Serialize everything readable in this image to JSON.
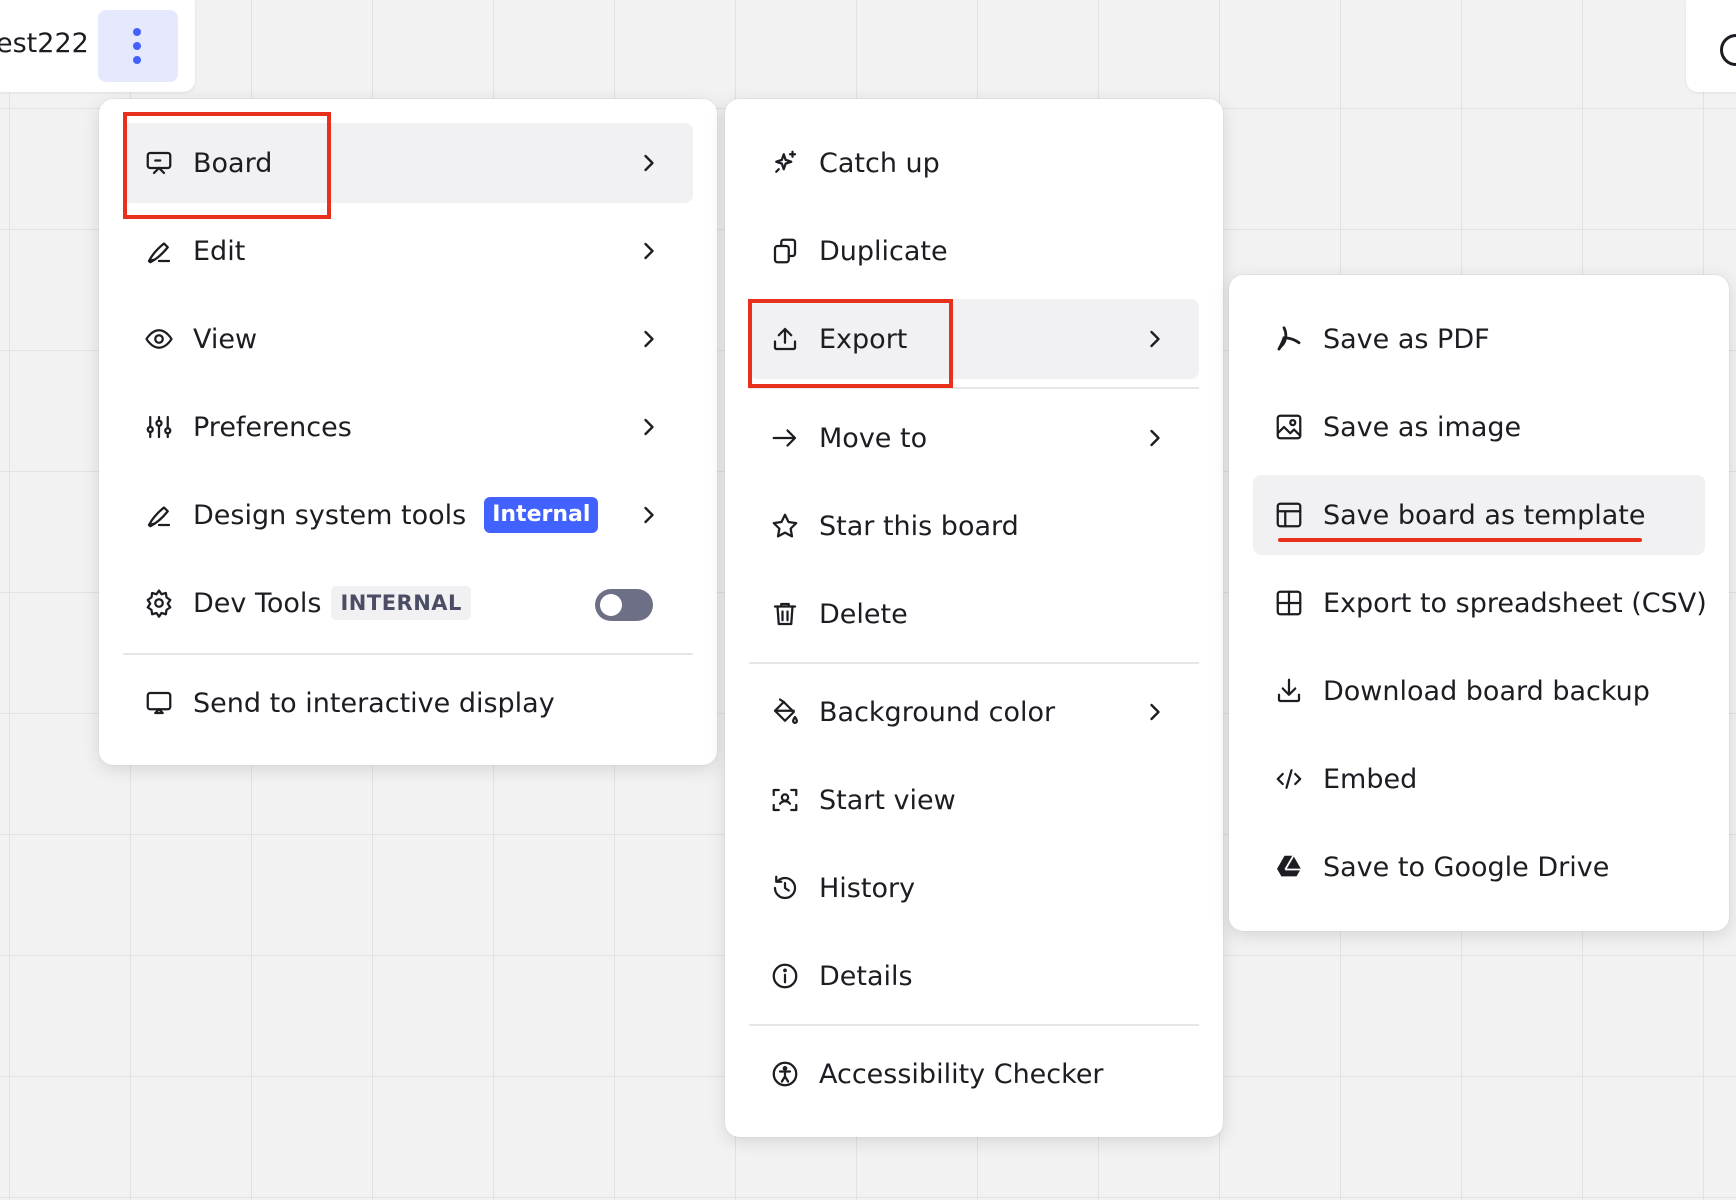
{
  "header": {
    "board_name": "est222"
  },
  "menu_board": {
    "items": [
      {
        "label": "Board",
        "icon": "presentation-board-icon",
        "submenu": true,
        "active": true
      },
      {
        "label": "Edit",
        "icon": "pen-icon",
        "submenu": true
      },
      {
        "label": "View",
        "icon": "eye-icon",
        "submenu": true
      },
      {
        "label": "Preferences",
        "icon": "sliders-icon",
        "submenu": true
      },
      {
        "label": "Design system tools",
        "icon": "pen-icon",
        "badge": "Internal",
        "submenu": true
      },
      {
        "label": "Dev Tools",
        "icon": "gear-icon",
        "badge": "INTERNAL",
        "toggle": false
      }
    ],
    "footer_item": {
      "label": "Send to interactive display",
      "icon": "display-icon"
    }
  },
  "menu_actions": {
    "items": [
      {
        "label": "Catch up",
        "icon": "sparkle-icon"
      },
      {
        "label": "Duplicate",
        "icon": "duplicate-icon"
      },
      {
        "label": "Export",
        "icon": "upload-icon",
        "submenu": true,
        "active": true
      },
      {
        "label": "Move to",
        "icon": "arrow-right-icon",
        "submenu": true
      },
      {
        "label": "Star this board",
        "icon": "star-icon"
      },
      {
        "label": "Delete",
        "icon": "trash-icon"
      },
      {
        "label": "Background color",
        "icon": "paint-bucket-icon",
        "submenu": true
      },
      {
        "label": "Start view",
        "icon": "start-view-icon"
      },
      {
        "label": "History",
        "icon": "history-icon"
      },
      {
        "label": "Details",
        "icon": "info-icon"
      },
      {
        "label": "Accessibility Checker",
        "icon": "accessibility-icon"
      }
    ]
  },
  "menu_export": {
    "items": [
      {
        "label": "Save as PDF",
        "icon": "pdf-icon"
      },
      {
        "label": "Save as image",
        "icon": "image-icon"
      },
      {
        "label": "Save board as template",
        "icon": "template-icon",
        "active": true
      },
      {
        "label": "Export to spreadsheet (CSV)",
        "icon": "grid-icon"
      },
      {
        "label": "Download board backup",
        "icon": "download-icon"
      },
      {
        "label": "Embed",
        "icon": "code-icon"
      },
      {
        "label": "Save to Google Drive",
        "icon": "google-drive-icon"
      }
    ]
  },
  "colors": {
    "accent": "#4262ff",
    "highlight": "#e8301c",
    "active_bg": "#f1f1f3",
    "toggle_off": "#6c6f85"
  }
}
